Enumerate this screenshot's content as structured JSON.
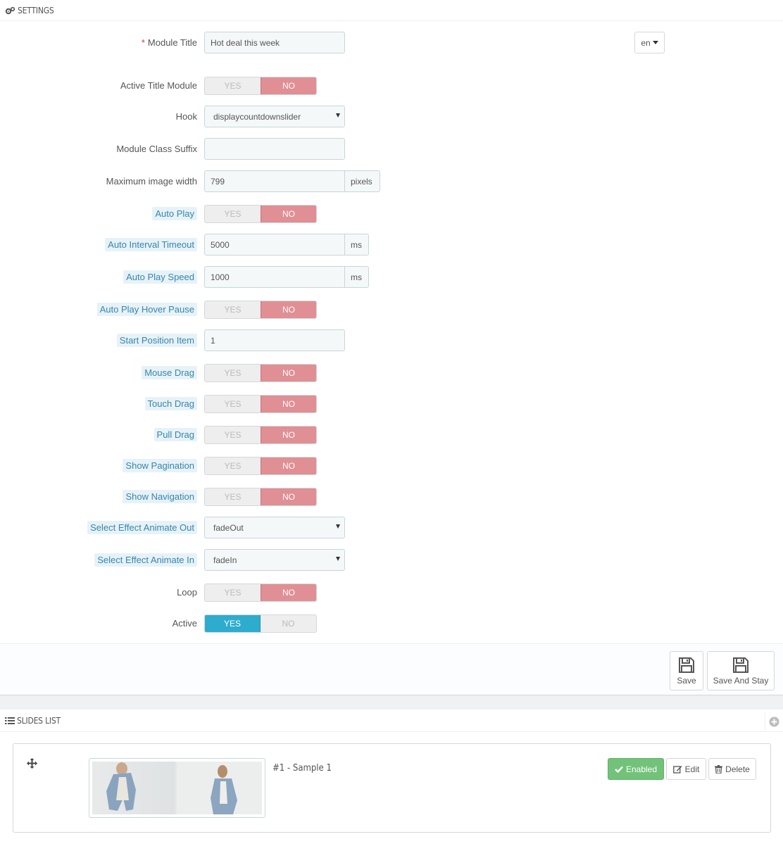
{
  "settings": {
    "title": "SETTINGS",
    "module_title": {
      "label": "Module Title",
      "required": "*",
      "value": "Hot deal this week",
      "lang": "en"
    },
    "active_title_module": {
      "label": "Active Title Module",
      "value": "NO"
    },
    "hook": {
      "label": "Hook",
      "value": "displaycountdownslider"
    },
    "module_class_suffix": {
      "label": "Module Class Suffix",
      "value": ""
    },
    "max_image_width": {
      "label": "Maximum image width",
      "value": "799",
      "unit": "pixels"
    },
    "auto_play": {
      "label": "Auto Play",
      "value": "NO"
    },
    "auto_interval_timeout": {
      "label": "Auto Interval Timeout",
      "value": "5000",
      "unit": "ms"
    },
    "auto_play_speed": {
      "label": "Auto Play Speed",
      "value": "1000",
      "unit": "ms"
    },
    "auto_play_hover_pause": {
      "label": "Auto Play Hover Pause",
      "value": "NO"
    },
    "start_position_item": {
      "label": "Start Position Item",
      "value": "1"
    },
    "mouse_drag": {
      "label": "Mouse Drag",
      "value": "NO"
    },
    "touch_drag": {
      "label": "Touch Drag",
      "value": "NO"
    },
    "pull_drag": {
      "label": "Pull Drag",
      "value": "NO"
    },
    "show_pagination": {
      "label": "Show Pagination",
      "value": "NO"
    },
    "show_navigation": {
      "label": "Show Navigation",
      "value": "NO"
    },
    "effect_animate_out": {
      "label": "Select Effect Animate Out",
      "value": "fadeOut"
    },
    "effect_animate_in": {
      "label": "Select Effect Animate In",
      "value": "fadeIn"
    },
    "loop": {
      "label": "Loop",
      "value": "NO"
    },
    "active": {
      "label": "Active",
      "value": "YES"
    },
    "switch_yes": "YES",
    "switch_no": "NO"
  },
  "footer": {
    "save_label": "Save",
    "save_stay_label": "Save And Stay"
  },
  "slides": {
    "title": "SLIDES LIST",
    "items": [
      {
        "title": "#1 - Sample 1",
        "status_label": "Enabled",
        "edit_label": "Edit",
        "delete_label": "Delete"
      }
    ]
  },
  "colors": {
    "no_active": "#e08f95",
    "yes_active": "#2eacce",
    "enabled": "#72c279",
    "help_label_bg": "#e7f2f8",
    "help_label_text": "#3586ae"
  }
}
